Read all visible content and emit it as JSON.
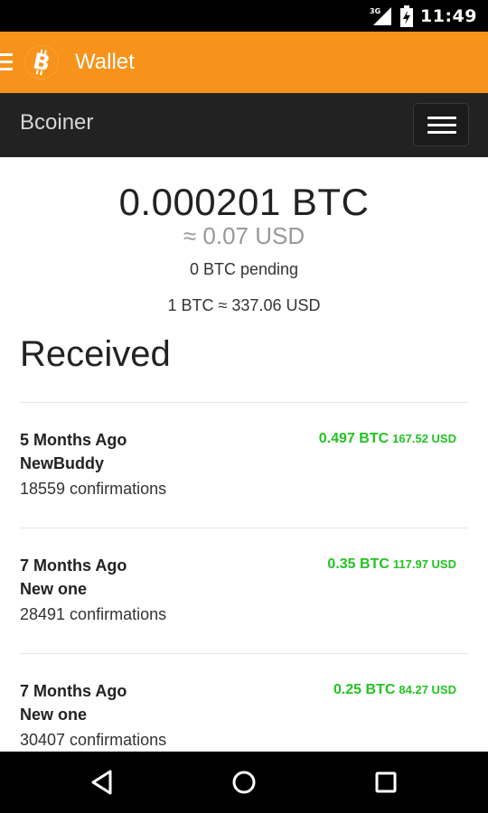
{
  "status_bar": {
    "network": "3G",
    "time": "11:49",
    "icons": [
      "signal-icon",
      "battery-charging-icon"
    ]
  },
  "app_bar": {
    "title": "Wallet",
    "icons": [
      "menu-icon",
      "bitcoin-logo"
    ],
    "color": "#f7931a"
  },
  "navbar": {
    "brand": "Bcoiner",
    "toggle_icon": "hamburger-icon"
  },
  "wallet": {
    "balance": "0.000201 BTC",
    "balance_usd": "≈ 0.07 USD",
    "pending": "0 BTC pending",
    "rate": "1 BTC ≈ 337.06 USD"
  },
  "received": {
    "heading": "Received",
    "transactions": [
      {
        "when": "5 Months Ago",
        "label": "NewBuddy",
        "confirmations": "18559 confirmations",
        "btc": "0.497 BTC",
        "usd": "167.52 USD"
      },
      {
        "when": "7 Months Ago",
        "label": "New one",
        "confirmations": "28491 confirmations",
        "btc": "0.35 BTC",
        "usd": "117.97 USD"
      },
      {
        "when": "7 Months Ago",
        "label": "New one",
        "confirmations": "30407 confirmations",
        "btc": "0.25 BTC",
        "usd": "84.27 USD"
      }
    ],
    "amount_color": "#22c322"
  },
  "nav_bar": {
    "icons": [
      "back-icon",
      "home-icon",
      "recents-icon"
    ]
  }
}
